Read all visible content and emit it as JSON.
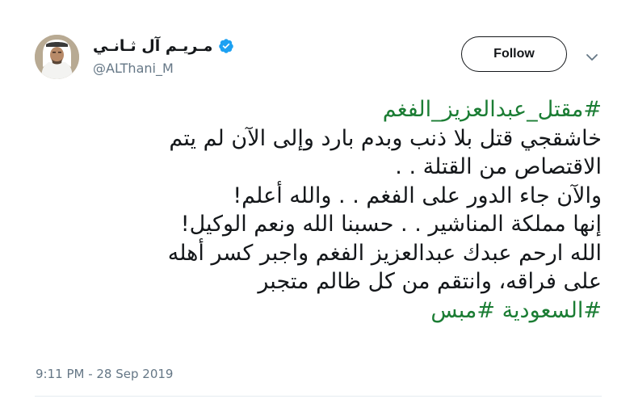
{
  "user": {
    "display_name": "مـريـم آل ثـانـي",
    "handle": "@ALThani_M",
    "verified": true
  },
  "header": {
    "follow_label": "Follow"
  },
  "tweet": {
    "hashtag_top": "#مقتل_عبدالعزيز_الفغم",
    "lines": [
      "خاشقجي قتل بلا ذنب وبدم بارد وإلى الآن لم يتم",
      "الاقتصاص من القتلة . .",
      "والآن جاء الدور على الفغم . .  والله أعلم!",
      "إنها مملكة المناشير . . حسبنا الله ونعم الوكيل!",
      "الله ارحم عبدك عبدالعزيز الفغم واجبر كسر أهله",
      "على فراقه، وانتقم من كل ظالم متجبر"
    ],
    "hashtags_bottom": [
      "#السعودية",
      "#مبس"
    ],
    "timestamp": "9:11 PM - 28 Sep 2019"
  },
  "colors": {
    "hashtag": "#1b7d34",
    "verified_badge": "#1da1f2",
    "text": "#14171a",
    "muted": "#657786"
  },
  "icons": {
    "verified": "verified-badge-icon",
    "menu": "chevron-down-icon"
  }
}
